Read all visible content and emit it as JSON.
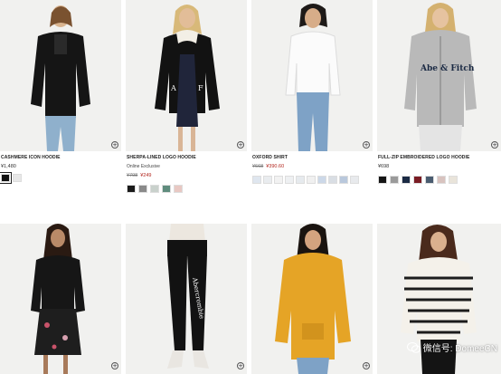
{
  "products": [
    {
      "name": "CASHMERE ICON HOODIE",
      "price": "¥1,480",
      "swatches": [
        "#111111",
        "#e8e8e8"
      ],
      "selected": 0
    },
    {
      "name": "SHERPA-LINED LOGO HOODIE",
      "note": "Online Exclusive",
      "old_price": "¥798",
      "sale_price": "¥249",
      "swatches": [
        "#1a1a1a",
        "#8a8a8a",
        "#c9d1cc",
        "#5f8c7d",
        "#e8c8c3"
      ]
    },
    {
      "name": "OXFORD SHIRT",
      "old_price": "¥668",
      "sale_price": "¥390.60",
      "swatches": [
        "#dfe6ef",
        "#e9ecef",
        "#f2f2f2",
        "#eef0f2",
        "#e6eaee",
        "#f0f0f0",
        "#ccd8e8",
        "#d9dee4",
        "#b9c8dc",
        "#e8eaed"
      ]
    },
    {
      "name": "FULL-ZIP EMBROIDERED LOGO HOODIE",
      "price": "¥698",
      "swatches": [
        "#151515",
        "#9a9a9a",
        "#1b2a44",
        "#7a1c24",
        "#4a5c70",
        "#d8c3bf",
        "#e9e4da"
      ]
    },
    {
      "name": ""
    },
    {
      "name": ""
    },
    {
      "name": ""
    },
    {
      "name": ""
    }
  ],
  "watermark": "微信号: DomeeCN",
  "icons": {
    "quick_add": "plus-circle-icon",
    "watermark": "wechat-icon"
  },
  "colors": {
    "sale": "#b3261e",
    "background": "#ffffff",
    "photo_bg": "#f1f1ef"
  }
}
